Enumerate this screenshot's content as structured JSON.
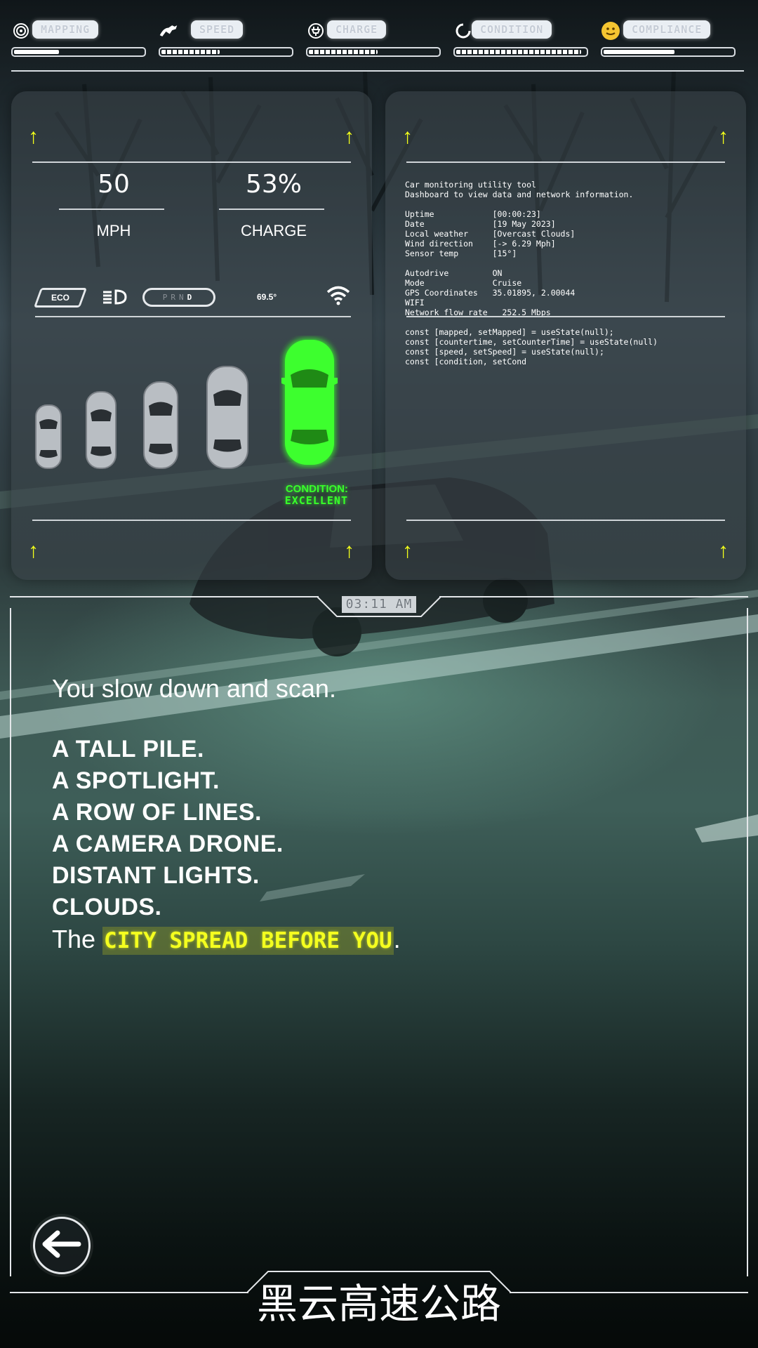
{
  "status_bar": [
    {
      "label": "MAPPING",
      "icon": "target-icon",
      "progress": 0.35,
      "style": "solid"
    },
    {
      "label": "SPEED",
      "icon": "running-dog-icon",
      "progress": 0.45,
      "style": "dots"
    },
    {
      "label": "CHARGE",
      "icon": "plug-icon",
      "progress": 0.53,
      "style": "dots"
    },
    {
      "label": "CONDITION",
      "icon": "spinner-icon",
      "progress": 0.97,
      "style": "dots"
    },
    {
      "label": "COMPLIANCE",
      "icon": "smiley-icon",
      "progress": 0.55,
      "style": "solid"
    }
  ],
  "dashboard": {
    "speed_value": "50",
    "speed_unit": "MPH",
    "charge_value": "53%",
    "charge_unit": "CHARGE",
    "eco_label": "ECO",
    "gears": [
      "P",
      "R",
      "N",
      "D"
    ],
    "active_gear": "D",
    "temperature": "69.5°",
    "condition_label": "CONDITION:",
    "condition_value": "EXCELLENT",
    "condition_color": "#38ff2a"
  },
  "info_panel": {
    "lines": [
      "Car monitoring utility tool",
      "Dashboard to view data and network information.",
      "",
      "Uptime            [00:00:23]",
      "Date              [19 May 2023]",
      "Local weather     [Overcast Clouds]",
      "Wind direction    [-> 6.29 Mph]",
      "Sensor temp       [15°]",
      "",
      "Autodrive         ON",
      "Mode              Cruise",
      "GPS Coordinates   35.01895, 2.00044",
      "WIFI",
      "Network flow rate   252.5 Mbps"
    ],
    "code_lines": [
      "const [mapped, setMapped] = useState(null);",
      "const [countertime, setCounterTime] = useState(null)",
      "const [speed, setSpeed] = useState(null);",
      "const [condition, setCond"
    ]
  },
  "clock": "03:11 AM",
  "story": {
    "lead": "You slow down and scan.",
    "items": [
      "A TALL PILE.",
      "A SPOTLIGHT.",
      "A ROW OF LINES.",
      "A CAMERA DRONE.",
      "DISTANT LIGHTS.",
      "CLOUDS."
    ],
    "last_prefix": "The ",
    "last_highlight": "CITY SPREAD BEFORE YOU",
    "last_suffix": "."
  },
  "footer_title": "黑云高速公路",
  "accent_color": "#f4ff1f"
}
